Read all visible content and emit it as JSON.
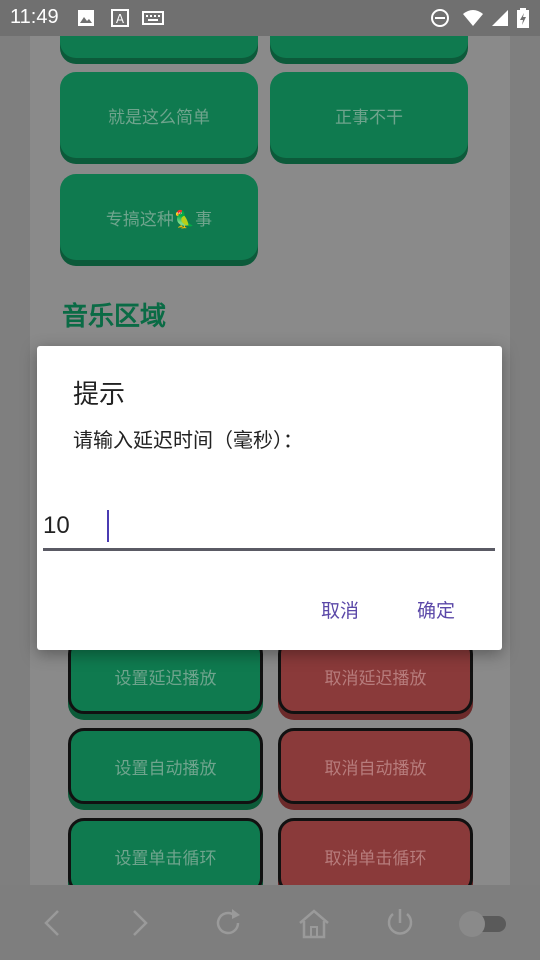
{
  "status_bar": {
    "time": "11:49",
    "icons": [
      "image-icon",
      "a-text-icon",
      "keyboard-icon",
      "do-not-disturb-icon",
      "wifi-icon",
      "signal-icon",
      "battery-icon"
    ]
  },
  "grid": {
    "buttons": [
      "就是这么简单",
      "正事不干",
      "专搞这种🦜事"
    ]
  },
  "music_section": {
    "title": "音乐区域",
    "rows": [
      {
        "left": "设置延迟播放",
        "right": "取消延迟播放"
      },
      {
        "left": "设置自动播放",
        "right": "取消自动播放"
      },
      {
        "left": "设置单击循环",
        "right": "取消单击循环"
      }
    ]
  },
  "dialog": {
    "title": "提示",
    "message": "请输入延迟时间（毫秒）：",
    "input_value": "10",
    "cancel_label": "取消",
    "ok_label": "确定"
  },
  "colors": {
    "accent": "#5b48a8",
    "green": "#0f7a4f",
    "red": "#8a3a3a"
  },
  "bottom_nav": {
    "icons": [
      "back-icon",
      "forward-icon",
      "refresh-icon",
      "home-icon",
      "power-icon",
      "toggle-switch"
    ]
  }
}
